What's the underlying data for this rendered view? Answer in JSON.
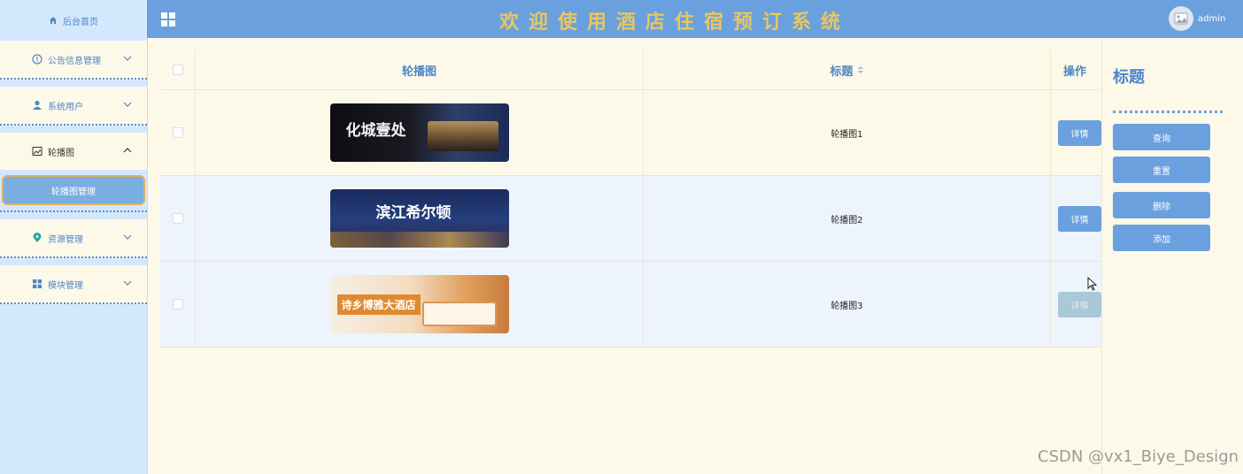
{
  "header": {
    "title": "欢迎使用酒店住宿预订系统",
    "username": "admin"
  },
  "sidebar": {
    "home": "后台首页",
    "items": [
      {
        "label": "公告信息管理"
      },
      {
        "label": "系统用户"
      },
      {
        "label": "轮播图",
        "sub": "轮播图管理"
      },
      {
        "label": "资源管理"
      },
      {
        "label": "模块管理"
      }
    ]
  },
  "table": {
    "headers": {
      "image": "轮播图",
      "title": "标题",
      "op": "操作"
    },
    "rows": [
      {
        "title": "轮播图1",
        "banner_text": "化城壹处",
        "action": "详情"
      },
      {
        "title": "轮播图2",
        "banner_text": "滨江希尔顿",
        "action": "详情"
      },
      {
        "title": "轮播图3",
        "banner_text": "诗乡博雅大酒店",
        "action": "详情"
      }
    ]
  },
  "panel": {
    "title": "标题",
    "buttons": {
      "query": "查询",
      "reset": "重置",
      "delete": "删除",
      "add": "添加"
    }
  },
  "watermark": "CSDN @vx1_Biye_Design",
  "colors": {
    "accent": "#6aa0dd",
    "sidebar": "#d4e8fd",
    "background": "#fdf9e9",
    "title_gold": "#e8c760"
  }
}
